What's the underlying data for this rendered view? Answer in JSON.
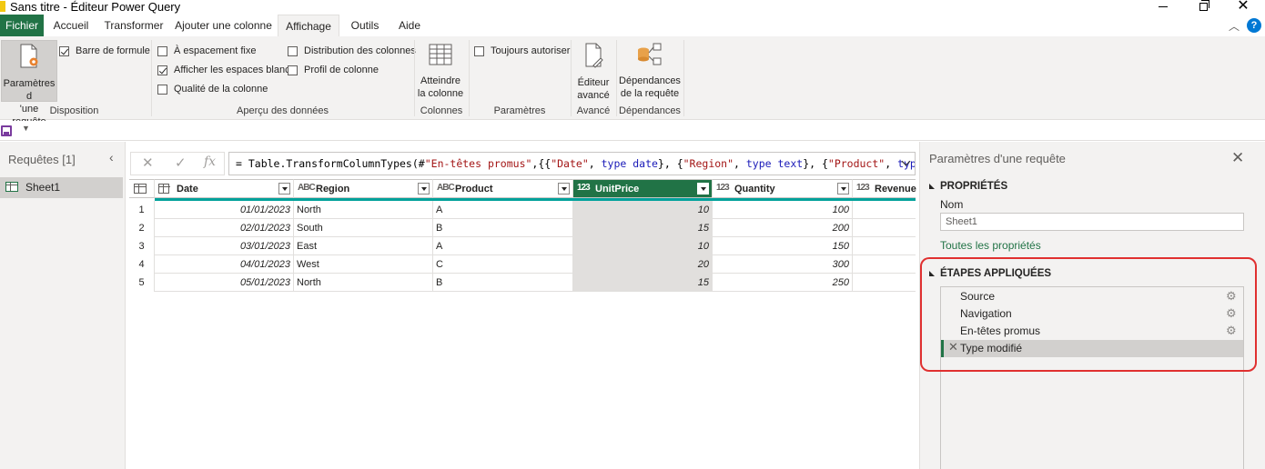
{
  "window": {
    "title": "Sans titre - Éditeur Power Query"
  },
  "tabs": [
    {
      "label": "Fichier"
    },
    {
      "label": "Accueil"
    },
    {
      "label": "Transformer"
    },
    {
      "label": "Ajouter une colonne"
    },
    {
      "label": "Affichage"
    },
    {
      "label": "Outils"
    },
    {
      "label": "Aide"
    }
  ],
  "ribbon": {
    "disposition": {
      "query_settings_l1": "Paramètres d",
      "query_settings_l2": "'une requête",
      "formula_bar": "Barre de formule",
      "label": "Disposition"
    },
    "apercu": {
      "fixed_spacing": "À espacement fixe",
      "show_whitespace": "Afficher les espaces blancs",
      "column_quality": "Qualité de la colonne",
      "column_distribution": "Distribution des colonnes",
      "column_profile": "Profil de colonne",
      "label": "Aperçu des données"
    },
    "colonnes": {
      "goto_l1": "Atteindre",
      "goto_l2": "la colonne",
      "label": "Colonnes"
    },
    "parametres": {
      "always_allow": "Toujours autoriser",
      "label": "Paramètres"
    },
    "avance": {
      "editor_l1": "Éditeur",
      "editor_l2": "avancé",
      "label": "Avancé"
    },
    "dependances": {
      "deps_l1": "Dépendances",
      "deps_l2": "de la requête",
      "label": "Dépendances"
    }
  },
  "left_pane": {
    "title": "Requêtes [1]",
    "queries": [
      {
        "name": "Sheet1"
      }
    ]
  },
  "formula_bar": {
    "prefix": "= Table.TransformColumnTypes(#",
    "s1": "\"En-têtes promus\"",
    "p1": ",{{",
    "s2": "\"Date\"",
    "p2": ", ",
    "k1": "type date",
    "p3": "}, {",
    "s3": "\"Region\"",
    "p4": ", ",
    "k2": "type text",
    "p5": "}, {",
    "s4": "\"Product\"",
    "p6": ", ",
    "k3": "type"
  },
  "table": {
    "columns": [
      {
        "type": "date-type-icon",
        "type_text": "",
        "name": "Date"
      },
      {
        "type": "text-type-icon",
        "type_text": "ABC",
        "name": "Region"
      },
      {
        "type": "text-type-icon",
        "type_text": "ABC",
        "name": "Product"
      },
      {
        "type": "number-type-icon",
        "type_text": "123",
        "name": "UnitPrice"
      },
      {
        "type": "number-type-icon",
        "type_text": "123",
        "name": "Quantity"
      },
      {
        "type": "number-type-icon",
        "type_text": "123",
        "name": "Revenue"
      }
    ],
    "rows": [
      {
        "n": "1",
        "date": "01/01/2023",
        "region": "North",
        "product": "A",
        "price": "10",
        "qty": "100"
      },
      {
        "n": "2",
        "date": "02/01/2023",
        "region": "South",
        "product": "B",
        "price": "15",
        "qty": "200"
      },
      {
        "n": "3",
        "date": "03/01/2023",
        "region": "East",
        "product": "A",
        "price": "10",
        "qty": "150"
      },
      {
        "n": "4",
        "date": "04/01/2023",
        "region": "West",
        "product": "C",
        "price": "20",
        "qty": "300"
      },
      {
        "n": "5",
        "date": "05/01/2023",
        "region": "North",
        "product": "B",
        "price": "15",
        "qty": "250"
      }
    ]
  },
  "right_pane": {
    "title": "Paramètres d'une requête",
    "properties_title": "PROPRIÉTÉS",
    "name_label": "Nom",
    "name_value": "Sheet1",
    "all_properties": "Toutes les propriétés",
    "steps_title": "ÉTAPES APPLIQUÉES",
    "steps": [
      {
        "label": "Source"
      },
      {
        "label": "Navigation"
      },
      {
        "label": "En-têtes promus"
      },
      {
        "label": "Type modifié"
      }
    ]
  },
  "colors": {
    "accent": "#217346",
    "highlight": "#e03030"
  }
}
